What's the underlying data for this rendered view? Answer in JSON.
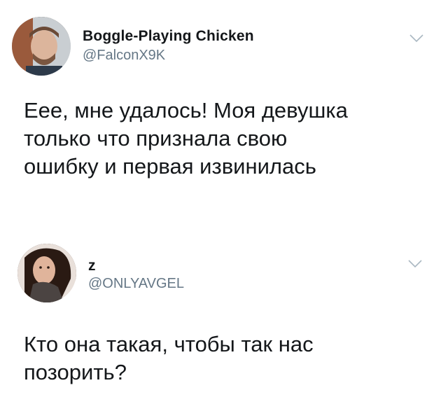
{
  "tweets": [
    {
      "display_name": "Boggle-Playing Chicken",
      "handle": "@FalconX9K",
      "text_lines": [
        "Еее, мне удалось! Моя девушка",
        "только что признала свою",
        "ошибку и первая извинилась"
      ],
      "avatar_icon": "user-avatar-photo",
      "menu_icon": "chevron-down-icon"
    },
    {
      "display_name": "z",
      "handle": "@ONLYAVGEL",
      "text_lines": [
        "Кто она такая, чтобы так нас",
        "позорить?"
      ],
      "avatar_icon": "user-avatar-photo",
      "menu_icon": "chevron-down-icon"
    }
  ],
  "colors": {
    "text": "#14171a",
    "secondary_text": "#657786",
    "chevron": "#aab8c2",
    "background": "#ffffff"
  }
}
